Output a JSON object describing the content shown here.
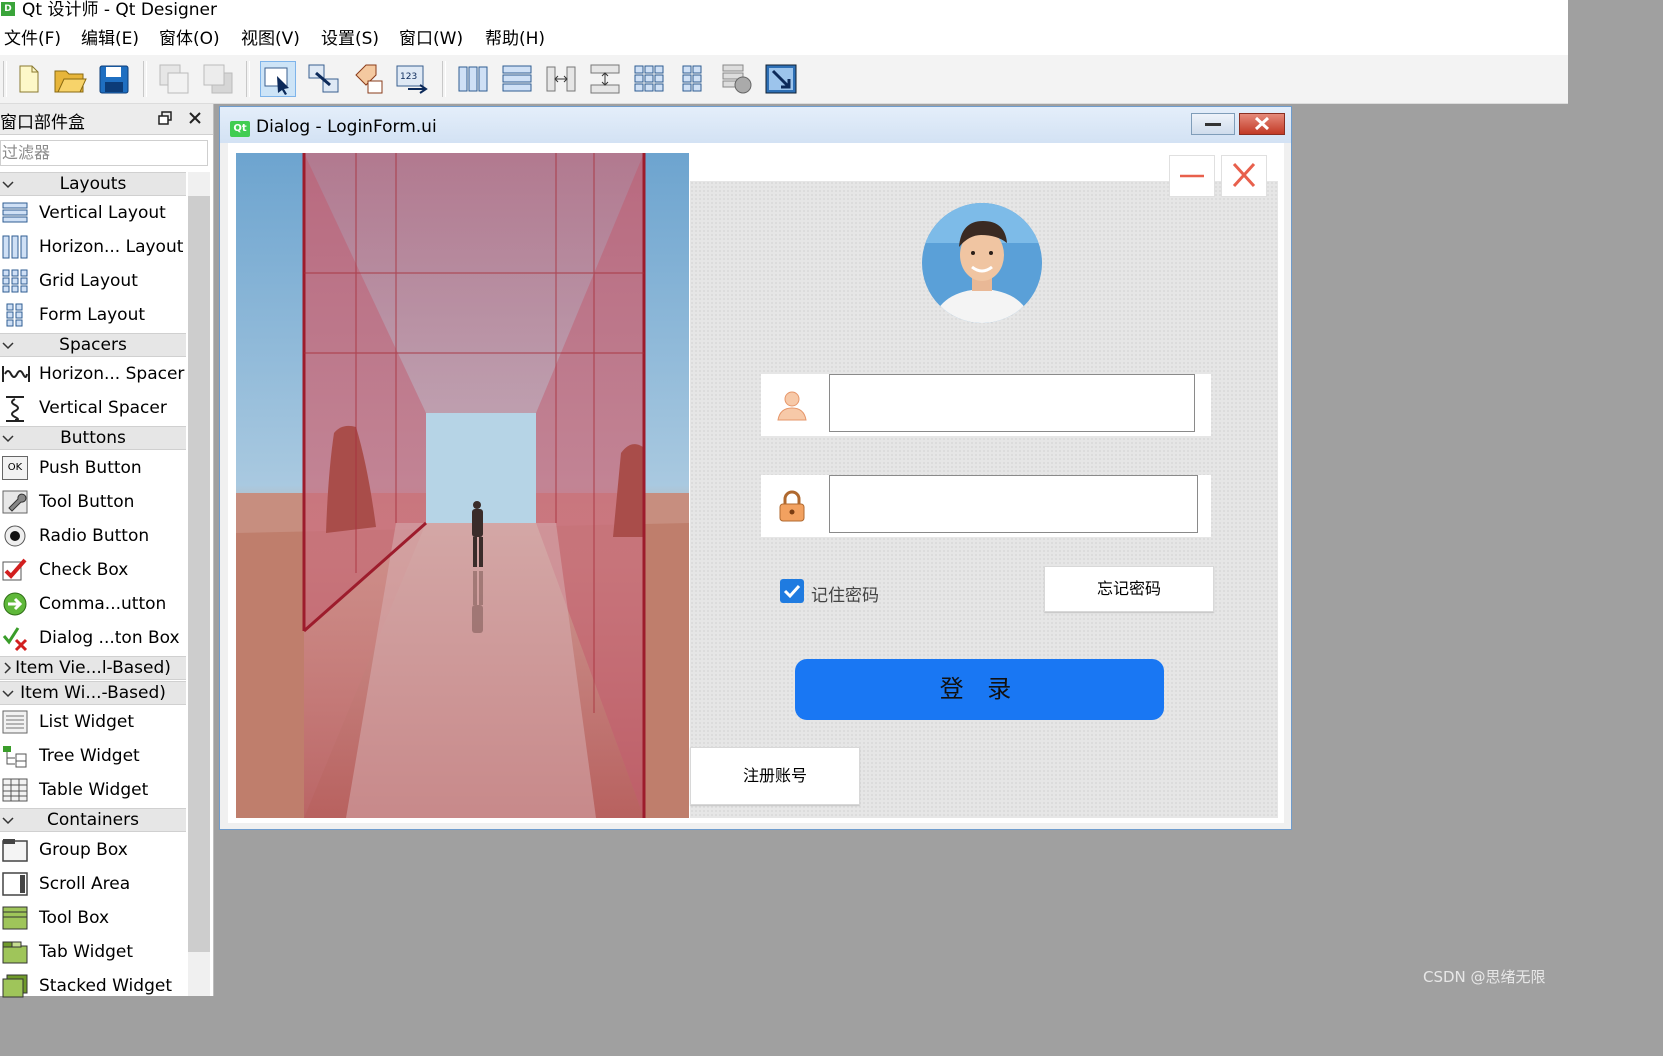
{
  "app": {
    "logo_letter": "D",
    "window_title": "Qt 设计师 - Qt Designer"
  },
  "menubar": {
    "items": [
      "文件(F)",
      "编辑(E)",
      "窗体(O)",
      "视图(V)",
      "设置(S)",
      "窗口(W)",
      "帮助(H)"
    ]
  },
  "toolbar": {
    "icons": [
      "new-form-icon",
      "open-form-icon",
      "save-form-icon",
      "bring-to-front-icon",
      "send-to-back-icon",
      "edit-widgets-icon",
      "edit-signals-slots-icon",
      "edit-buddies-icon",
      "edit-tab-order-icon",
      "lay-out-horizontally-icon",
      "lay-out-vertically-icon",
      "horizontal-splitter-icon",
      "vertical-splitter-icon",
      "grid-layout-icon",
      "form-layout-icon",
      "break-layout-icon",
      "adjust-size-icon"
    ]
  },
  "widget_box": {
    "title": "窗口部件盒",
    "filter_placeholder": "过滤器",
    "categories": {
      "layouts": "Layouts",
      "spacers": "Spacers",
      "buttons": "Buttons",
      "item_views": "Item Vie...l-Based)",
      "item_widgets": "Item Wi...-Based)",
      "containers": "Containers"
    },
    "items": {
      "vertical_layout": "Vertical Layout",
      "horizontal_layout": "Horizon... Layout",
      "grid_layout": "Grid Layout",
      "form_layout": "Form Layout",
      "horizontal_spacer": "Horizon... Spacer",
      "vertical_spacer": "Vertical Spacer",
      "push_button": "Push Button",
      "tool_button": "Tool Button",
      "radio_button": "Radio Button",
      "check_box": "Check Box",
      "command_link_button": "Comma...utton",
      "dialog_button_box": "Dialog ...ton Box",
      "list_widget": "List Widget",
      "tree_widget": "Tree Widget",
      "table_widget": "Table Widget",
      "group_box": "Group Box",
      "scroll_area": "Scroll Area",
      "tool_box": "Tool Box",
      "tab_widget": "Tab Widget",
      "stacked_widget": "Stacked Widget"
    },
    "ok_icon_text": "OK"
  },
  "dialog": {
    "qt_badge": "Qt",
    "title": "Dialog - LoginForm.ui",
    "login_form": {
      "remember_label": "记住密码",
      "remember_checked": true,
      "forgot_button": "忘记密码",
      "login_button": "登 录",
      "register_button": "注册账号",
      "username_value": "",
      "password_value": ""
    }
  },
  "watermark": "CSDN @思绪无限",
  "colors": {
    "login_button": "#1977f3",
    "checkbox": "#1f7be0",
    "close_x": "#e8604c"
  }
}
